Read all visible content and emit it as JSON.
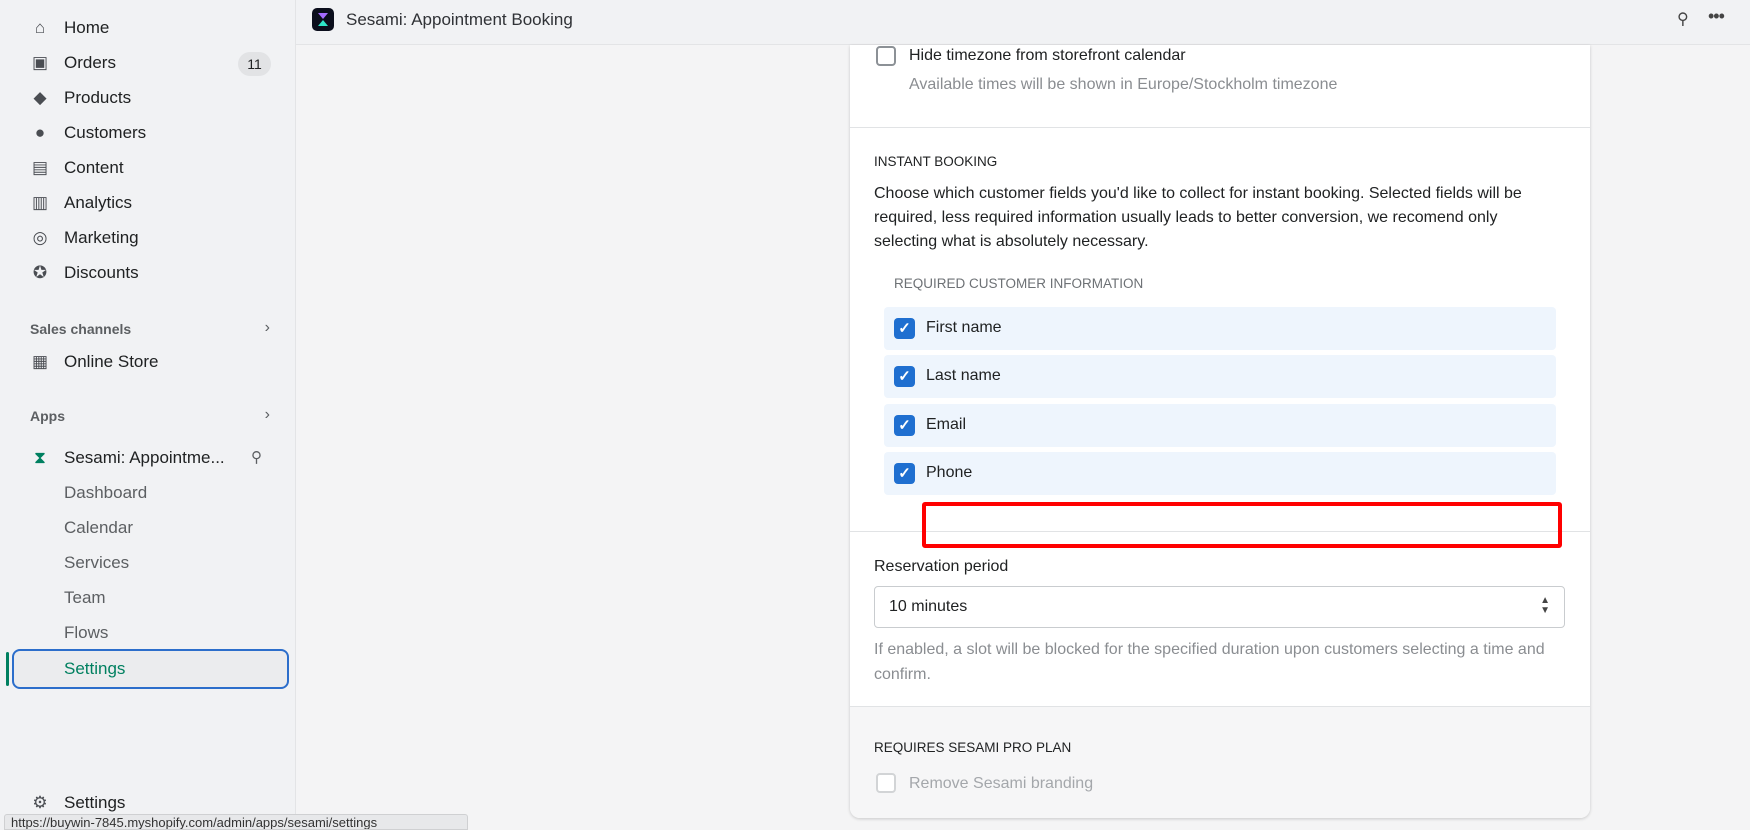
{
  "sidebar": {
    "items": [
      {
        "label": "Home",
        "icon": "home-icon"
      },
      {
        "label": "Orders",
        "icon": "orders-icon",
        "badge": "11"
      },
      {
        "label": "Products",
        "icon": "tag-icon"
      },
      {
        "label": "Customers",
        "icon": "person-icon"
      },
      {
        "label": "Content",
        "icon": "content-icon"
      },
      {
        "label": "Analytics",
        "icon": "bar-chart-icon"
      },
      {
        "label": "Marketing",
        "icon": "target-icon"
      },
      {
        "label": "Discounts",
        "icon": "discount-icon"
      }
    ],
    "sales_channels": "Sales channels",
    "online_store": "Online Store",
    "apps": "Apps",
    "app_name": "Sesami: Appointme...",
    "app_subitems": [
      "Dashboard",
      "Calendar",
      "Services",
      "Team",
      "Flows",
      "Settings"
    ],
    "settings": "Settings",
    "accent": "#008060"
  },
  "status_url": "https://buywin-7845.myshopify.com/admin/apps/sesami/settings",
  "topbar": {
    "title": "Sesami: Appointment Booking"
  },
  "main": {
    "hide_timezone_label": "Hide timezone from storefront calendar",
    "hide_timezone_checked": false,
    "hide_timezone_help": "Available times will be shown in Europe/Stockholm timezone",
    "instant_booking_heading": "INSTANT BOOKING",
    "instant_booking_desc": "Choose which customer fields you'd like to collect for instant booking. Selected fields will be required, less required information usually leads to better conversion, we recomend only selecting what is absolutely necessary.",
    "required_heading": "REQUIRED CUSTOMER INFORMATION",
    "fields": [
      {
        "label": "First name",
        "checked": true
      },
      {
        "label": "Last name",
        "checked": true
      },
      {
        "label": "Email",
        "checked": true
      },
      {
        "label": "Phone",
        "checked": true
      }
    ],
    "reservation_label": "Reservation period",
    "reservation_value": "10 minutes",
    "reservation_help": "If enabled, a slot will be blocked for the specified duration upon customers selecting a time and confirm.",
    "pro_heading": "REQUIRES SESAMI PRO PLAN",
    "remove_branding_label": "Remove Sesami branding",
    "remove_branding_checked": false
  },
  "highlight_color": "#ff0000"
}
